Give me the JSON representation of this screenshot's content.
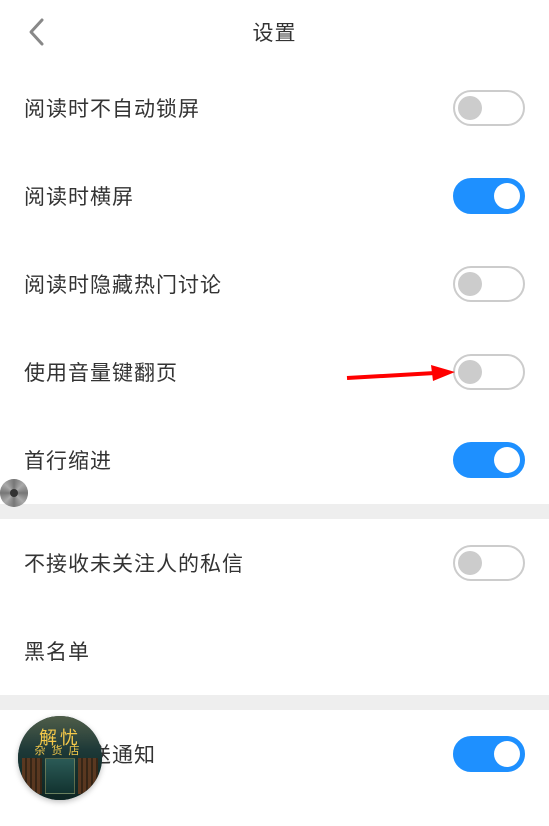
{
  "header": {
    "title": "设置"
  },
  "group1": [
    {
      "label": "阅读时不自动锁屏",
      "on": false
    },
    {
      "label": "阅读时横屏",
      "on": true
    },
    {
      "label": "阅读时隐藏热门讨论",
      "on": false
    },
    {
      "label": "使用音量键翻页",
      "on": false,
      "highlighted": true
    },
    {
      "label": "首行缩进",
      "on": true
    }
  ],
  "group2": [
    {
      "label": "不接收未关注人的私信",
      "on": false,
      "type": "toggle"
    },
    {
      "label": "黑名单",
      "type": "link"
    }
  ],
  "group3": [
    {
      "label": "接受推送通知",
      "on": true,
      "type": "toggle"
    }
  ],
  "float_cover": {
    "line1": "解忧",
    "line2": "杂货店"
  }
}
